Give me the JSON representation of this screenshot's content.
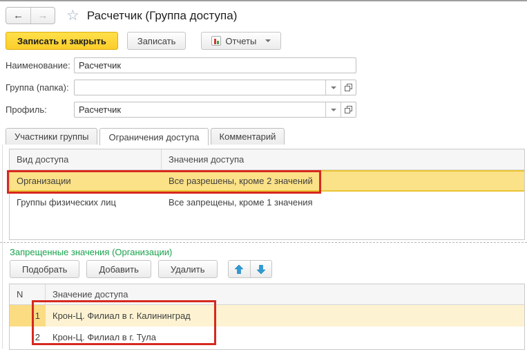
{
  "window": {
    "title": "Расчетчик (Группа доступа)"
  },
  "toolbar": {
    "save_and_close": "Записать и закрыть",
    "save": "Записать",
    "reports": "Отчеты"
  },
  "fields": {
    "name": {
      "label": "Наименование:",
      "value": "Расчетчик"
    },
    "group": {
      "label": "Группа (папка):",
      "value": ""
    },
    "profile": {
      "label": "Профиль:",
      "value": "Расчетчик"
    }
  },
  "tabs": [
    {
      "label": "Участники группы"
    },
    {
      "label": "Ограничения доступа"
    },
    {
      "label": "Комментарий"
    }
  ],
  "access_kinds_table": {
    "headers": [
      "Вид доступа",
      "Значения доступа"
    ],
    "rows": [
      {
        "kind": "Организации",
        "values": "Все разрешены, кроме 2 значений",
        "selected": true
      },
      {
        "kind": "Группы физических лиц",
        "values": "Все запрещены, кроме 1 значения",
        "selected": false
      }
    ]
  },
  "forbidden_values": {
    "caption": "Запрещенные значения (Организации)",
    "buttons": {
      "pick": "Подобрать",
      "add": "Добавить",
      "delete": "Удалить"
    },
    "table": {
      "headers": [
        "N",
        "Значение доступа"
      ],
      "rows": [
        {
          "n": "1",
          "value": "Крон-Ц. Филиал в г. Калининград",
          "selected": true
        },
        {
          "n": "2",
          "value": "Крон-Ц. Филиал в г. Тула",
          "selected": false
        }
      ]
    }
  },
  "colors": {
    "accent_yellow": "#fccd2a",
    "selection_yellow": "#fbe187",
    "annotation_red": "#d7281e",
    "caption_green": "#18a24b",
    "arrow_blue": "#2e9bd6"
  }
}
